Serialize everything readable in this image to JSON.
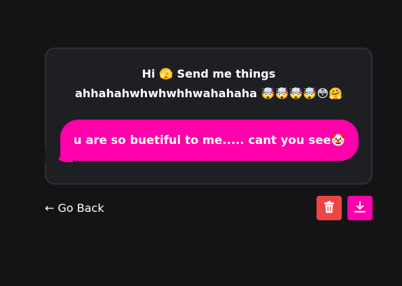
{
  "card": {
    "prompt_line1": "Hi 🫣 Send me things",
    "prompt_line2": "ahhahahwhwhwhhwahahaha 🤯🤯🤯🤯😳🤗"
  },
  "message": {
    "text": "u are so buetiful to me..... cant you see🤡"
  },
  "nav": {
    "back_label": "← Go Back"
  },
  "actions": {
    "delete_icon": "trash-icon",
    "download_icon": "download-icon"
  },
  "colors": {
    "background": "#141417",
    "card": "#1e1f23",
    "card_border": "#2f3035",
    "bubble": "#ff00aa",
    "delete_button": "#ef4444",
    "download_button": "#ff00aa",
    "text": "#ffffff"
  }
}
